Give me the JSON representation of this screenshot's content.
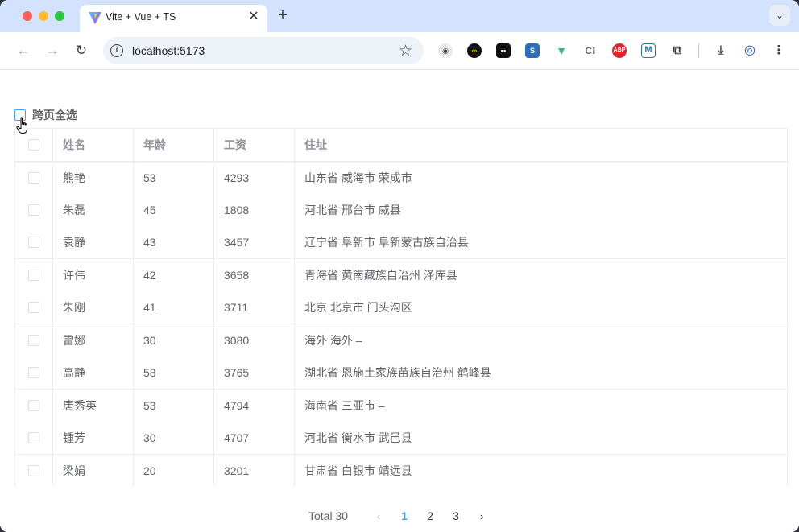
{
  "browser": {
    "tab_title": "Vite + Vue + TS",
    "url": "localhost:5173"
  },
  "page": {
    "select_all_label": "跨页全选",
    "columns": [
      "姓名",
      "年龄",
      "工资",
      "住址"
    ],
    "rows": [
      {
        "name": "熊艳",
        "age": "53",
        "salary": "4293",
        "address": "山东省 威海市 荣成市"
      },
      {
        "name": "朱磊",
        "age": "45",
        "salary": "1808",
        "address": "河北省 邢台市 威县"
      },
      {
        "name": "袁静",
        "age": "43",
        "salary": "3457",
        "address": "辽宁省 阜新市 阜新蒙古族自治县"
      },
      {
        "name": "许伟",
        "age": "42",
        "salary": "3658",
        "address": "青海省 黄南藏族自治州 泽库县"
      },
      {
        "name": "朱刚",
        "age": "41",
        "salary": "3711",
        "address": "北京 北京市 门头沟区"
      },
      {
        "name": "雷娜",
        "age": "30",
        "salary": "3080",
        "address": "海外 海外 –"
      },
      {
        "name": "高静",
        "age": "58",
        "salary": "3765",
        "address": "湖北省 恩施土家族苗族自治州 鹤峰县"
      },
      {
        "name": "唐秀英",
        "age": "53",
        "salary": "4794",
        "address": "海南省 三亚市 –"
      },
      {
        "name": "锺芳",
        "age": "30",
        "salary": "4707",
        "address": "河北省 衡水市 武邑县"
      },
      {
        "name": "梁娟",
        "age": "20",
        "salary": "3201",
        "address": "甘肃省 白银市 靖远县"
      }
    ],
    "pagination": {
      "total_label": "Total 30",
      "pages": [
        "1",
        "2",
        "3"
      ],
      "current_page": "1"
    }
  },
  "colors": {
    "accent": "#409eff",
    "tab_bar": "#d3e3fd"
  }
}
